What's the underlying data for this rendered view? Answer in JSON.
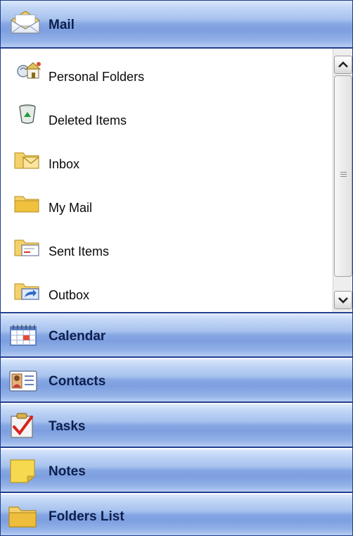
{
  "mail": {
    "title": "Mail",
    "icon": "mail-envelope-icon",
    "folders": [
      {
        "label": "Personal Folders",
        "icon": "personal-folders-icon"
      },
      {
        "label": "Deleted Items",
        "icon": "recycle-bin-icon"
      },
      {
        "label": "Inbox",
        "icon": "inbox-folder-icon"
      },
      {
        "label": "My Mail",
        "icon": "folder-icon"
      },
      {
        "label": "Sent Items",
        "icon": "sent-items-folder-icon"
      },
      {
        "label": "Outbox",
        "icon": "outbox-folder-icon"
      }
    ]
  },
  "sections": [
    {
      "label": "Calendar",
      "icon": "calendar-icon"
    },
    {
      "label": "Contacts",
      "icon": "contacts-card-icon"
    },
    {
      "label": "Tasks",
      "icon": "tasks-checkmark-icon"
    },
    {
      "label": "Notes",
      "icon": "sticky-note-icon"
    },
    {
      "label": "Folders List",
      "icon": "folder-icon"
    }
  ],
  "colors": {
    "bar_border": "#223e8f",
    "bar_text": "#0d1f4d",
    "folder_yellow": "#f2c94b"
  }
}
